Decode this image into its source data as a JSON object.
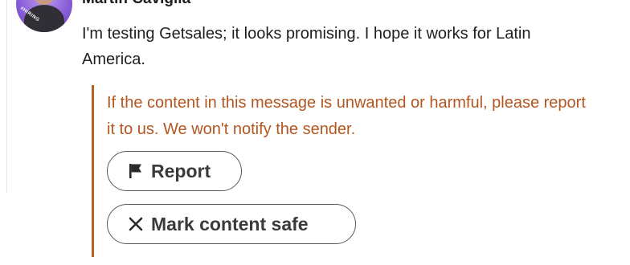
{
  "message": {
    "sender_name": "Martin Caviglia",
    "avatar_badge_text": "#HIRING",
    "body": "I'm testing Getsales; it looks promising. I hope it works for Latin America."
  },
  "safety_notice": {
    "text": "If the content in this message is unwanted or harmful, please report it to us. We won't notify the sender.",
    "accent_color": "#b65f26",
    "report_button": {
      "label": "Report",
      "icon": "flag-icon"
    },
    "mark_safe_button": {
      "label": "Mark content safe",
      "icon": "close-icon"
    }
  }
}
